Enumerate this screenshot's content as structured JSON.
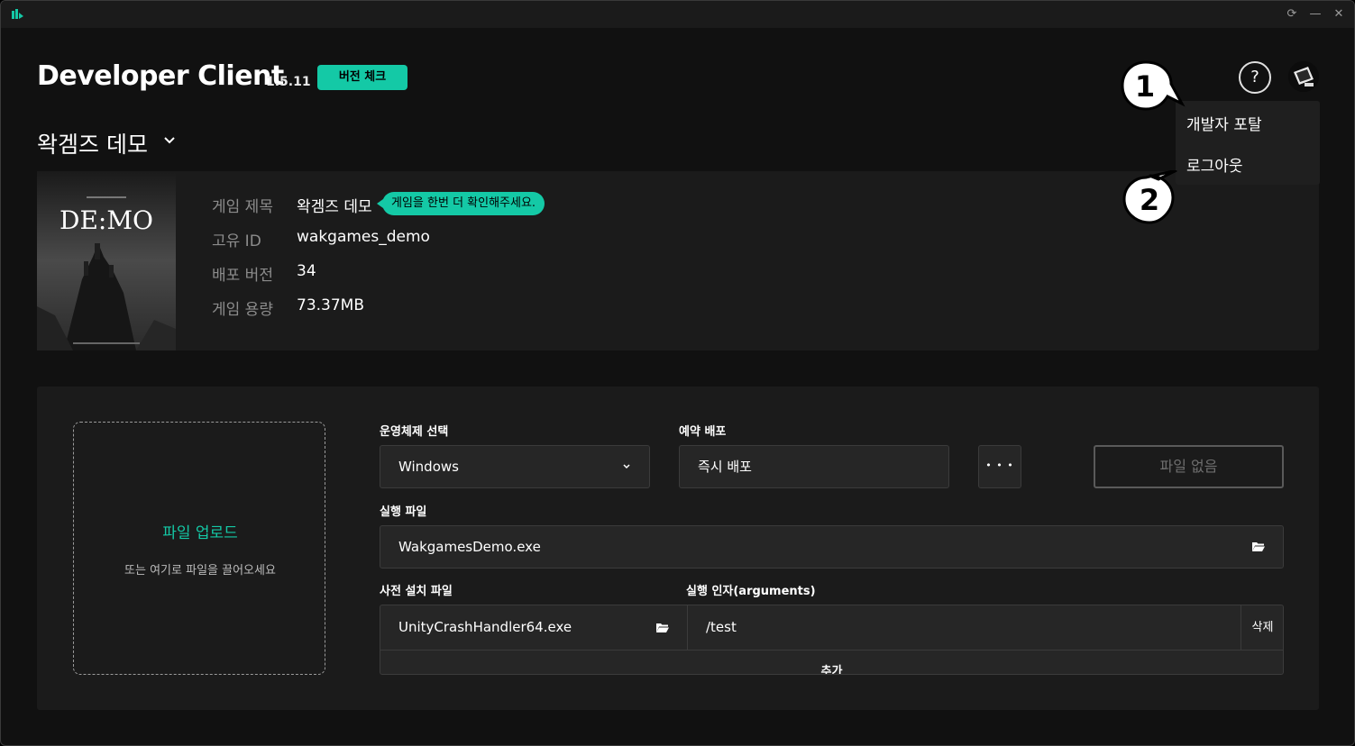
{
  "window": {
    "controls": {
      "refresh": "⟳",
      "minimize": "—",
      "close": "✕"
    }
  },
  "header": {
    "title": "Developer Client",
    "version": "1.5.11",
    "version_check_label": "버전 체크",
    "help_label": "?"
  },
  "game_selector": {
    "selected": "왁겜즈 데모"
  },
  "game_info": {
    "cover_title": "DE:MO",
    "rows": [
      {
        "label": "게임 제목",
        "value": "왁겜즈 데모"
      },
      {
        "label": "고유 ID",
        "value": "wakgames_demo"
      },
      {
        "label": "배포 버전",
        "value": "34"
      },
      {
        "label": "게임 용량",
        "value": "73.37MB"
      }
    ],
    "tooltip": "게임을 한번 더 확인해주세요."
  },
  "upload": {
    "title": "파일 업로드",
    "subtitle": "또는 여기로 파일을 끌어오세요"
  },
  "deploy": {
    "os_label": "운영체제 선택",
    "os_value": "Windows",
    "schedule_label": "예약 배포",
    "schedule_value": "즉시 배포",
    "more_label": "• • •",
    "no_file_label": "파일 없음",
    "exe_label": "실행 파일",
    "exe_value": "WakgamesDemo.exe",
    "preinstall_label": "사전 설치 파일",
    "preinstall_value": "UnityCrashHandler64.exe",
    "args_label": "실행 인자(arguments)",
    "args_value": "/test",
    "delete_label": "삭제",
    "add_label": "추가"
  },
  "user_menu": {
    "items": [
      "개발자 포탈",
      "로그아웃"
    ]
  },
  "annotations": {
    "one": "1",
    "two": "2"
  },
  "colors": {
    "accent": "#14c9a6",
    "background": "#111111",
    "panel": "#1b1b1b"
  }
}
